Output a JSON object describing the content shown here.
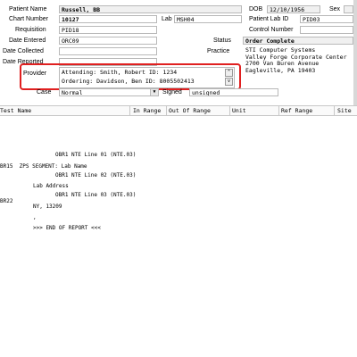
{
  "fields": {
    "patient_name_label": "Patient Name",
    "patient_name": "Russell, BB",
    "dob_label": "DOB",
    "dob": "12/10/1956",
    "sex_label": "Sex",
    "chart_number_label": "Chart Number",
    "chart_number": "10127",
    "lab_label": "Lab",
    "lab": "MSH04",
    "patient_lab_id_label": "Patient Lab ID",
    "patient_lab_id": "PID03",
    "requisition_label": "Requisition",
    "requisition": "PID18",
    "control_number_label": "Control Number",
    "date_entered_label": "Date Entered",
    "date_entered": "ORC09",
    "status_label": "Status",
    "status": "Order Complete",
    "date_collected_label": "Date Collected",
    "practice_label": "Practice",
    "practice_lines": [
      "STI Computer Systems",
      "Valley Forge Corporate Center",
      "2700 Van Buren Avenue",
      "Eagleville, PA 19403"
    ],
    "date_reported_label": "Date Reported",
    "provider_label": "Provider",
    "attending": "Attending:  Smith, Robert    ID: 1234",
    "ordering": "Ordering:   Davidson, Ben     ID: 8005502413",
    "case_label": "Case",
    "case": "Normal",
    "signed_label": "Signed",
    "signed": "unsigned"
  },
  "table": {
    "columns": [
      "Test Name",
      "In Range",
      "Out Of Range",
      "Unit",
      "Ref Range",
      "Site"
    ]
  },
  "report": {
    "nte_lines": [
      "OBR1 NTE Line 01 (NTE.03)",
      "OBR1 NTE Line 02 (NTE.03)",
      "OBR1 NTE Line 03 (NTE.03)"
    ],
    "zps_line": "BR15  ZPS SEGMENT: Lab Name",
    "zps_sub": [
      "Lab Address",
      "NY, 13209"
    ],
    "br22": "BR22",
    "tick": ",",
    "end": ">>> END OF REPORT <<<"
  },
  "colors": {
    "highlight": "#e02020"
  }
}
